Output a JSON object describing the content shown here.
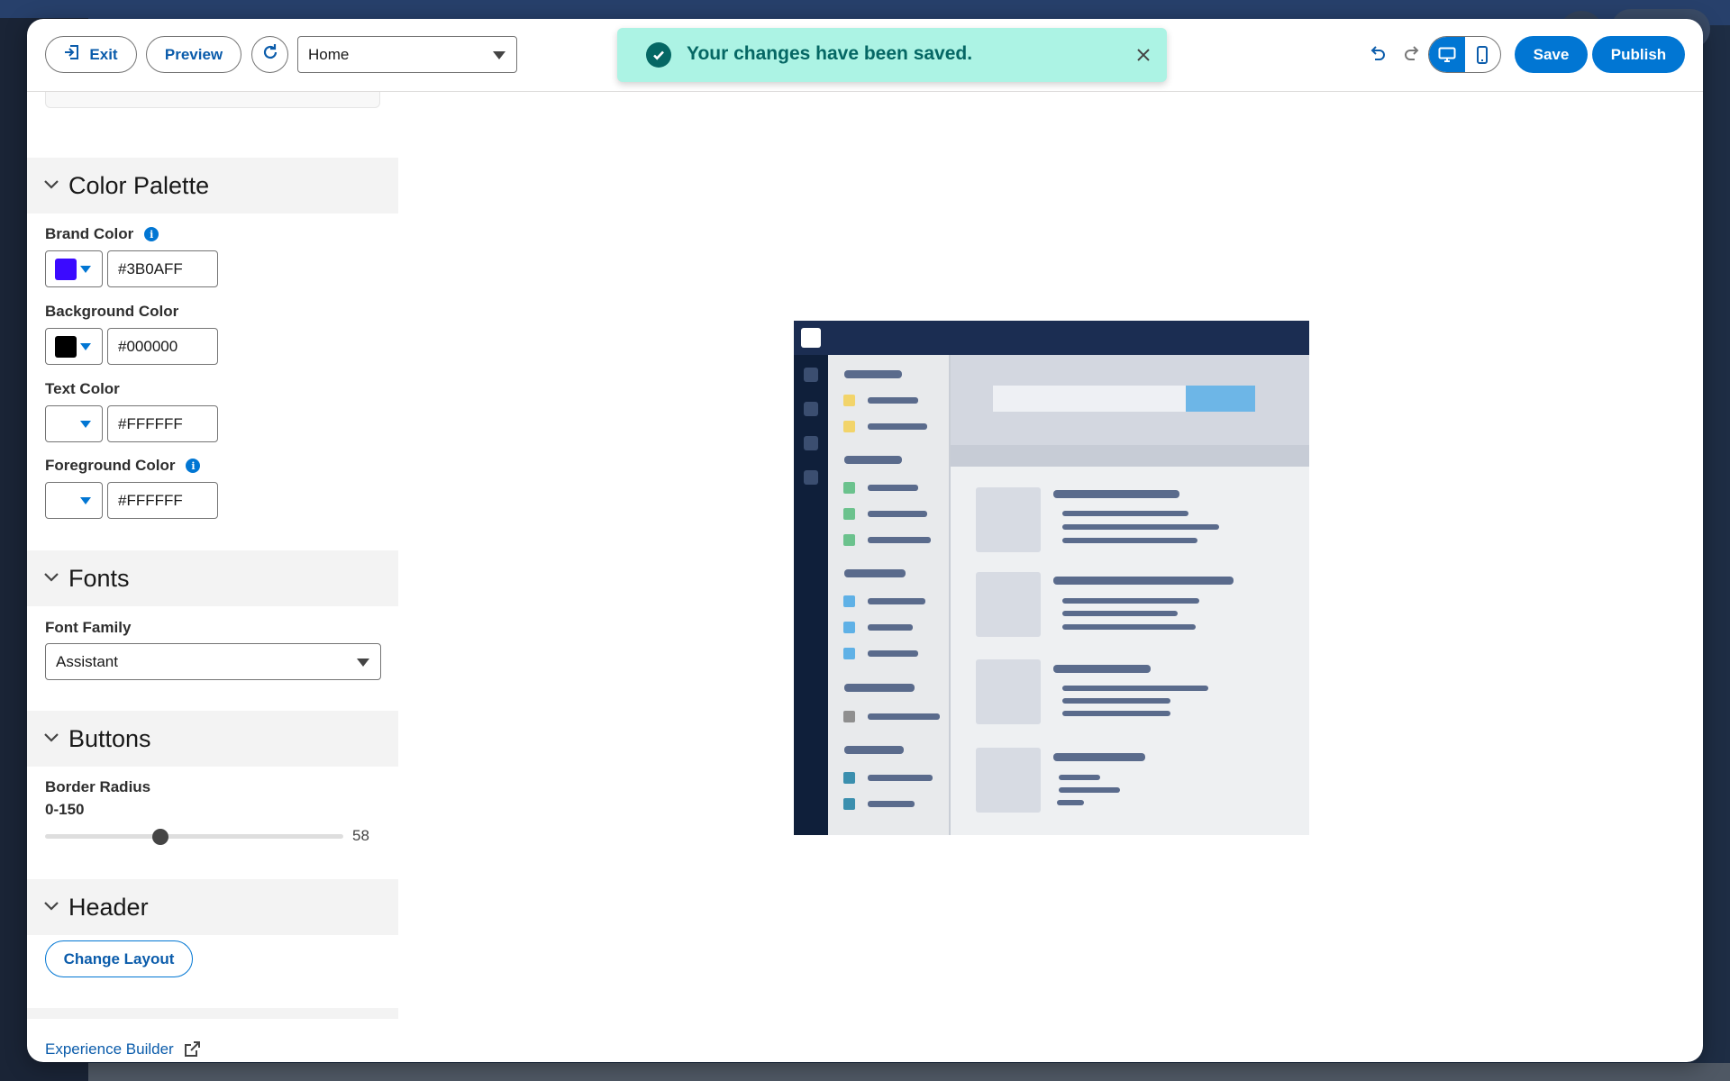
{
  "toolbar": {
    "exit_label": "Exit",
    "preview_label": "Preview",
    "page_select_value": "Home",
    "save_label": "Save",
    "publish_label": "Publish"
  },
  "toast": {
    "message": "Your changes have been saved."
  },
  "color_palette": {
    "title": "Color Palette",
    "brand": {
      "label": "Brand Color",
      "value": "#3B0AFF",
      "swatch": "#3b0aff"
    },
    "background": {
      "label": "Background Color",
      "value": "#000000",
      "swatch": "#000000"
    },
    "text": {
      "label": "Text Color",
      "value": "#FFFFFF",
      "swatch": "#ffffff"
    },
    "foreground": {
      "label": "Foreground Color",
      "value": "#FFFFFF",
      "swatch": "#ffffff"
    }
  },
  "fonts": {
    "title": "Fonts",
    "family_label": "Font Family",
    "family_value": "Assistant"
  },
  "buttons": {
    "title": "Buttons",
    "radius_label": "Border Radius",
    "radius_range": "0-150",
    "radius_value": "58",
    "radius_min": 0,
    "radius_max": 150,
    "radius_current": 58
  },
  "header": {
    "title": "Header",
    "change_layout_label": "Change Layout"
  },
  "footer": {
    "experience_builder_label": "Experience Builder"
  },
  "colors": {
    "accent": "#0176d3",
    "link": "#0b5cab",
    "toast_bg": "#acf3e4",
    "toast_text": "#056764"
  }
}
